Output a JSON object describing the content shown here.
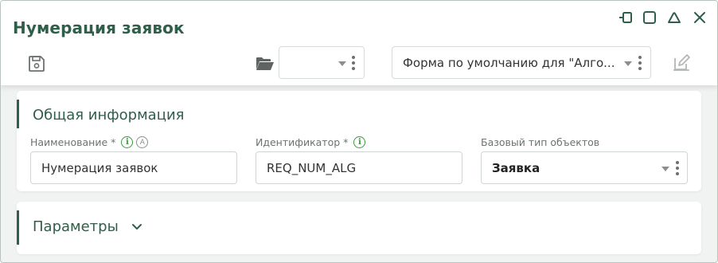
{
  "window": {
    "title": "Нумерация заявок",
    "controls": [
      "pin-icon",
      "maximize-icon",
      "collapse-icon",
      "close-icon"
    ]
  },
  "toolbar": {
    "save_icon": "save-icon",
    "folder_icon": "folder-open-icon",
    "small_select_value": "",
    "form_select_value": "Форма по умолчанию для \"Алго...",
    "edit_icon": "edit-icon"
  },
  "sections": {
    "general": {
      "title": "Общая информация",
      "name_field": {
        "label": "Наименование *",
        "value": "Нумерация заявок"
      },
      "id_field": {
        "label": "Идентификатор *",
        "value": "REQ_NUM_ALG"
      },
      "base_type_field": {
        "label": "Базовый тип объектов",
        "value": "Заявка"
      }
    },
    "params": {
      "title": "Параметры"
    }
  },
  "icons": {
    "info_glyph": "i",
    "auto_glyph": "A"
  },
  "colors": {
    "accent": "#2f5f4a",
    "info": "#3a9a3a",
    "background": "#f1f3f2"
  }
}
